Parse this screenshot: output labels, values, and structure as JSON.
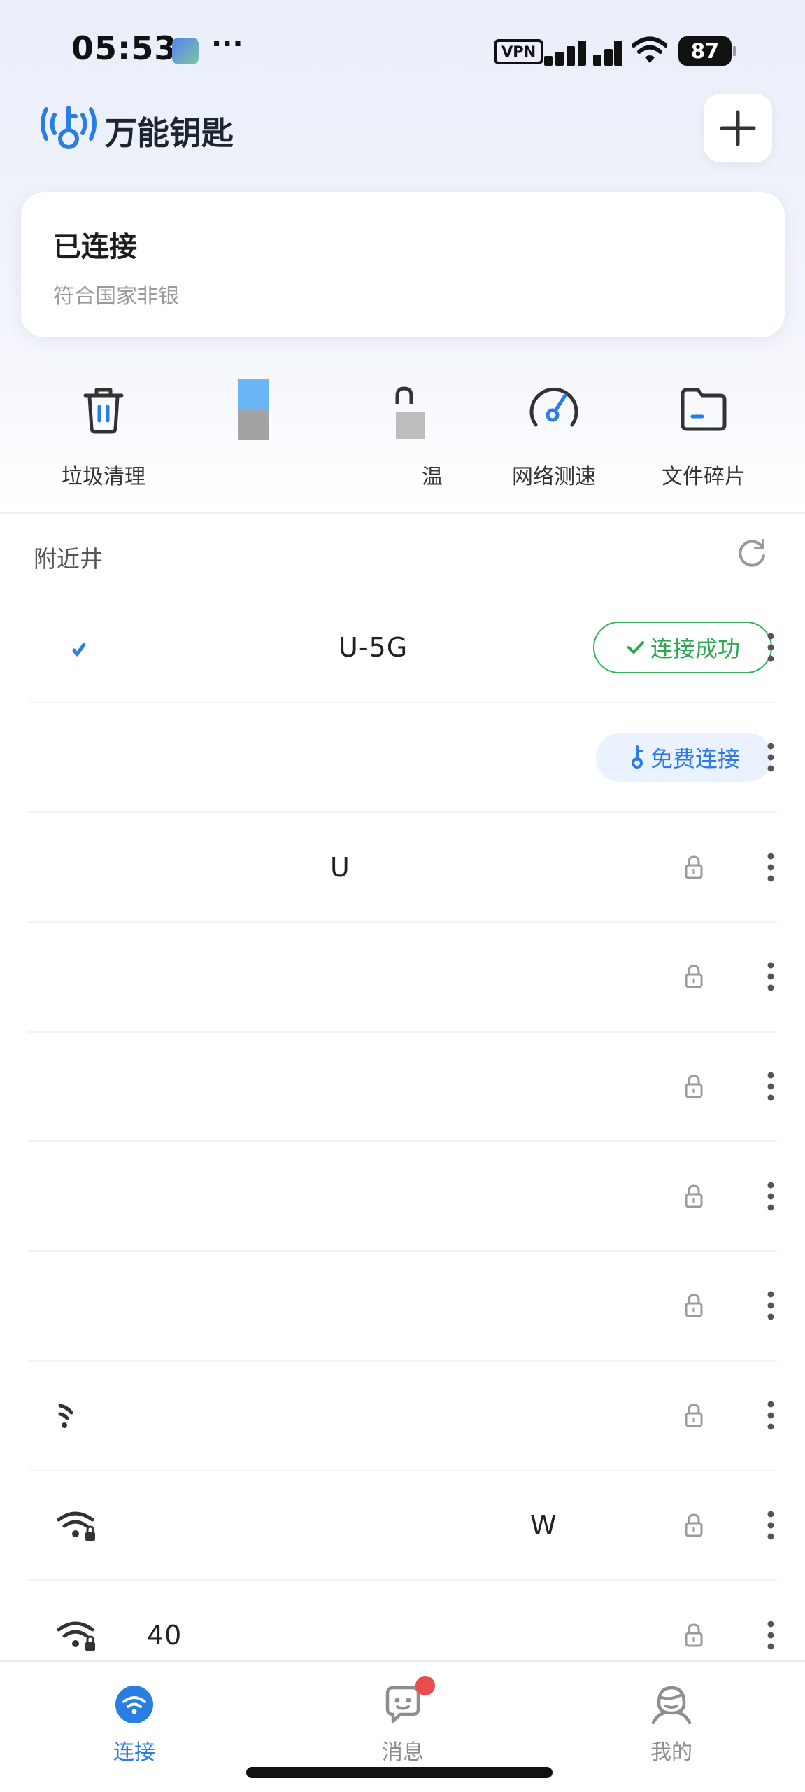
{
  "status_bar": {
    "time": "05:53",
    "dots": "···",
    "vpn": "VPN",
    "battery": "87"
  },
  "header": {
    "app_title": "万能钥匙",
    "add_icon": "plus-icon"
  },
  "connection": {
    "status": "已连接",
    "description": "符合国家非银"
  },
  "tools": [
    {
      "label": "垃圾清理",
      "icon": "trash-icon"
    },
    {
      "label": "",
      "icon": "app-icon"
    },
    {
      "label": "温",
      "icon": "lock-icon"
    },
    {
      "label": "网络测速",
      "icon": "speedometer-icon"
    },
    {
      "label": "文件碎片",
      "icon": "folder-icon"
    }
  ],
  "nearby": {
    "title": "附近井",
    "refresh_icon": "refresh-icon"
  },
  "networks": [
    {
      "name": "U-5G",
      "action": "连接成功",
      "state": "connected"
    },
    {
      "name": "",
      "action": "免费连接",
      "state": "free"
    },
    {
      "name": "U",
      "state": "locked"
    },
    {
      "name": "",
      "state": "locked"
    },
    {
      "name": "",
      "state": "locked"
    },
    {
      "name": "",
      "state": "locked"
    },
    {
      "name": "",
      "state": "locked"
    },
    {
      "name": "",
      "state": "locked"
    },
    {
      "name": "W",
      "state": "locked"
    },
    {
      "name": "40",
      "state": "locked"
    }
  ],
  "bottom_nav": [
    {
      "label": "连接",
      "icon": "wifi-icon",
      "active": true
    },
    {
      "label": "消息",
      "icon": "message-icon",
      "active": false
    },
    {
      "label": "我的",
      "icon": "profile-icon",
      "active": false
    }
  ],
  "colors": {
    "accent_blue": "#2a7de1",
    "success_green": "#35b35b",
    "badge_red": "#ec4b4b"
  }
}
